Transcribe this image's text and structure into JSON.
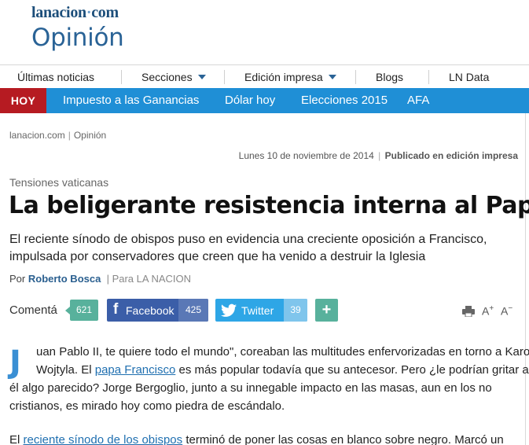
{
  "masthead": {
    "logo_part1": "lanacion",
    "logo_dot": "·",
    "logo_part2": "com",
    "section": "Opinión"
  },
  "mainnav": {
    "items": [
      {
        "label": "Últimas noticias"
      },
      {
        "label": "Secciones"
      },
      {
        "label": "Edición impresa"
      },
      {
        "label": "Blogs"
      },
      {
        "label": "LN Data"
      }
    ]
  },
  "topicbar": {
    "hoy": "HOY",
    "topics": [
      {
        "label": "Impuesto a las Ganancias"
      },
      {
        "label": "Dólar hoy"
      },
      {
        "label": "Elecciones 2015"
      },
      {
        "label": "AFA"
      }
    ],
    "colors": {
      "bar": "#1f8fd6",
      "hoy": "#b61b22"
    }
  },
  "breadcrumb": {
    "home": "lanacion.com",
    "separator": "|",
    "section": "Opinión"
  },
  "dateline": {
    "date": "Lunes 10 de noviembre de 2014",
    "separator": "|",
    "published": "Publicado en edición impresa"
  },
  "article": {
    "kicker": "Tensiones vaticanas",
    "headline": "La beligerante resistencia interna al Papa",
    "standfirst": "El reciente sínodo de obispos puso en evidencia una creciente oposición a Francisco, impulsada por conservadores que creen que ha venido a destruir la Iglesia",
    "byline_prefix": "Por",
    "author": "Roberto Bosca",
    "byline_sep": "|",
    "outlet": "Para LA NACION",
    "dropcap": "J",
    "p1_line1": "uan Pablo II, te quiere todo el mundo\", coreaban las multitudes enfervorizadas en torno a Karol",
    "p1_line2_pre": "Wojtyla. El ",
    "p1_line2_link": "papa Francisco",
    "p1_line2_post": " es más popular todavía que su antecesor. Pero ¿le podrían gritar a",
    "p1_line3": "él algo parecido? Jorge Bergoglio, junto a su innegable impacto en las masas, aun en los no",
    "p1_line4": "cristianos, es mirado hoy como piedra de escándalo.",
    "p2_pre": "El ",
    "p2_link": "reciente sínodo de los obispos",
    "p2_post": " terminó de poner las cosas en blanco sobre negro. Marcó un"
  },
  "share": {
    "comment_label": "Comentá",
    "comment_count": "621",
    "facebook_label": "Facebook",
    "facebook_count": "425",
    "twitter_label": "Twitter",
    "twitter_count": "39",
    "plus_label": "+",
    "font_increase": "A",
    "font_decrease": "A",
    "plus_sign": "+",
    "minus_sign": "−",
    "colors": {
      "facebook": "#3b5ea8",
      "twitter": "#2ea6e6",
      "comments": "#58b19c"
    }
  }
}
